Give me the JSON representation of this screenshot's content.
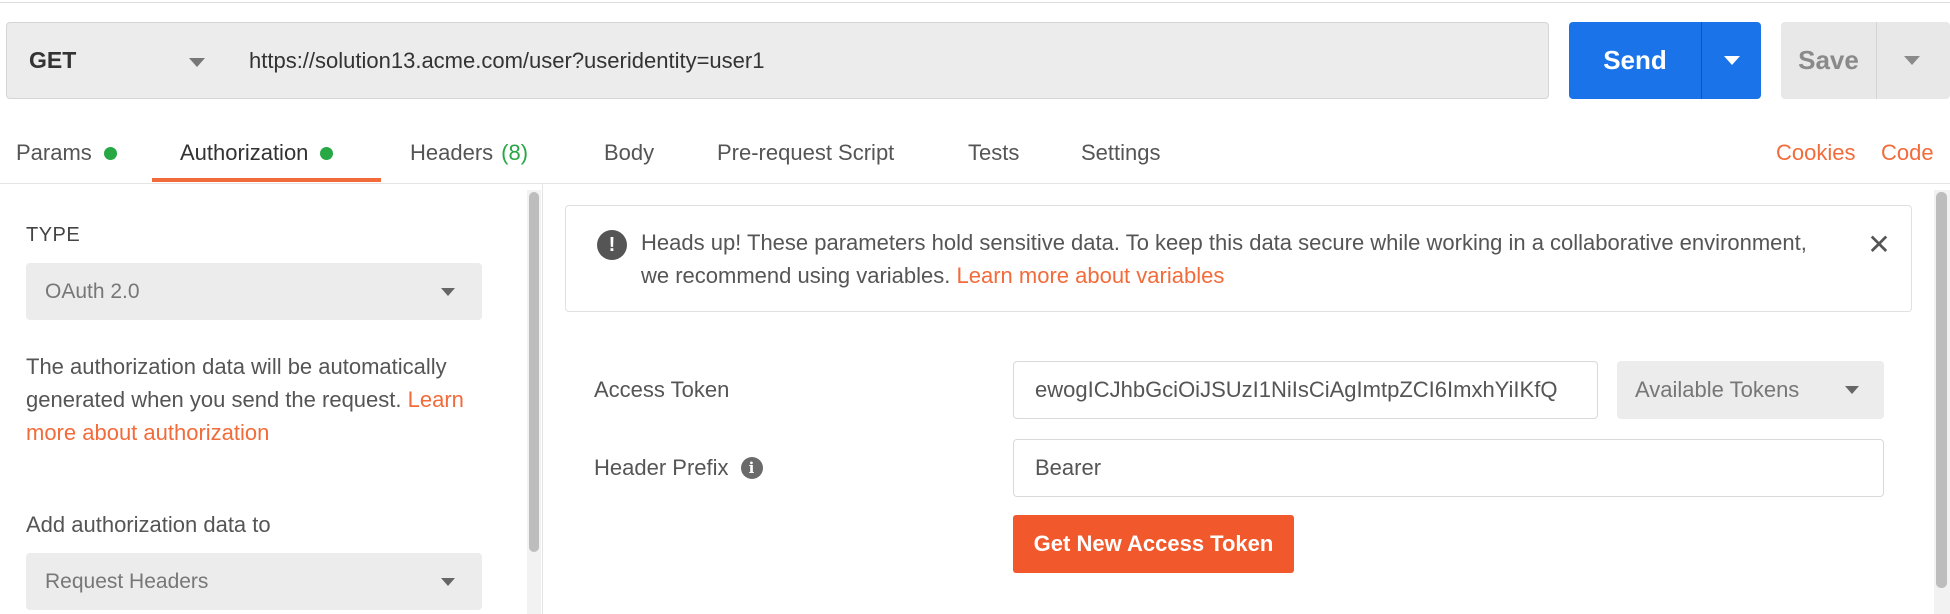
{
  "request": {
    "method": "GET",
    "url": "https://solution13.acme.com/user?useridentity=user1",
    "send_label": "Send",
    "save_label": "Save"
  },
  "tabs": [
    {
      "label": "Params",
      "dot": true
    },
    {
      "label": "Authorization",
      "dot": true,
      "active": true
    },
    {
      "label": "Headers",
      "count": "(8)"
    },
    {
      "label": "Body"
    },
    {
      "label": "Pre-request Script"
    },
    {
      "label": "Tests"
    },
    {
      "label": "Settings"
    }
  ],
  "links": {
    "cookies": "Cookies",
    "code": "Code"
  },
  "auth": {
    "type_label": "TYPE",
    "type_value": "OAuth 2.0",
    "description": "The authorization data will be automatically generated when you send the request.",
    "learn_more": "Learn more about authorization",
    "add_to_label": "Add authorization data to",
    "add_to_value": "Request Headers"
  },
  "alert": {
    "text": "Heads up! These parameters hold sensitive data. To keep this data secure while working in a collaborative environment, we recommend using variables.",
    "link": "Learn more about variables"
  },
  "fields": {
    "access_token_label": "Access Token",
    "access_token_value": "ewogICJhbGciOiJSUzI1NiIsCiAgImtpZCI6ImxhYiIKfQ",
    "available_tokens": "Available Tokens",
    "header_prefix_label": "Header Prefix",
    "header_prefix_value": "Bearer",
    "get_token_button": "Get New Access Token"
  },
  "colors": {
    "accent": "#f26b3a",
    "primary": "#1a73e8",
    "status_dot": "#28a745",
    "button_orange": "#f1582b"
  }
}
